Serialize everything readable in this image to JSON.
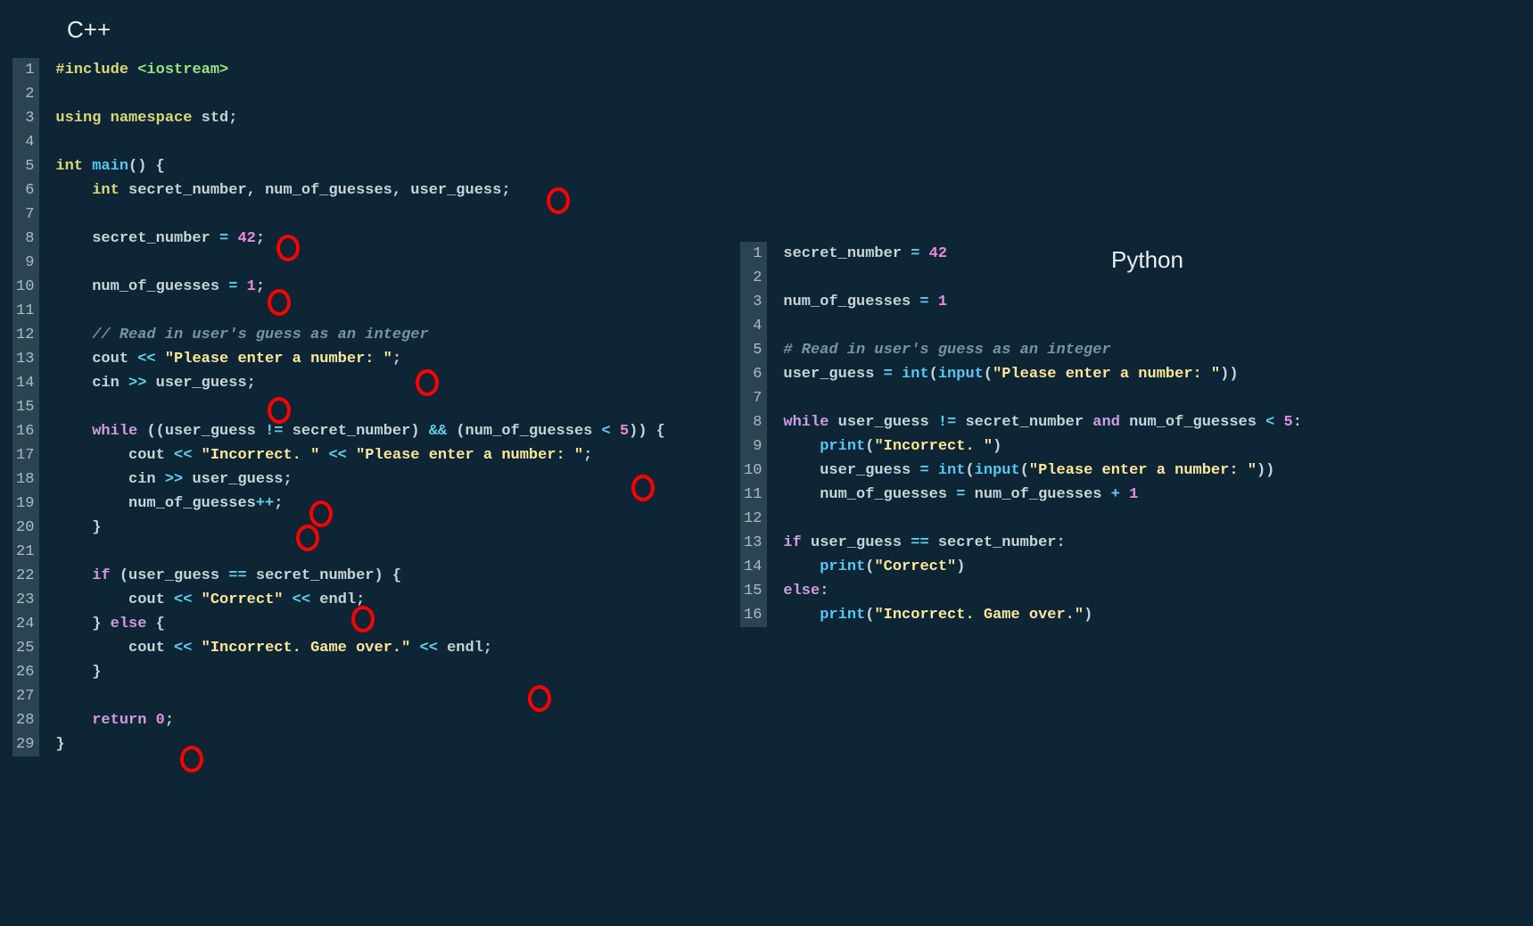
{
  "labels": {
    "cpp": "C++",
    "python": "Python"
  },
  "cpp": {
    "line_count": 29,
    "tokens": {
      "include": "#include ",
      "iostream": "<iostream>",
      "using": "using ",
      "namespace": "namespace ",
      "std": "std",
      "semi": ";",
      "int": "int ",
      "int2": "int ",
      "main": "main",
      "paren_open": "(",
      "paren_close": ")",
      "brace_open": " {",
      "brace_close": "}",
      "secret": "secret_number",
      "comma1": ", ",
      "numg": "num_of_guesses",
      "comma2": ", ",
      "userg": "user_guess",
      "assign": " = ",
      "n42": "42",
      "n1": "1",
      "cmt": "// Read in user's guess as an integer",
      "cout": "cout ",
      "cin": "cin ",
      "ltlt": "<< ",
      "gtgt": ">> ",
      "prompt": "\"Please enter a number: \"",
      "while": "while ",
      "neq": " != ",
      "ampamp": " && ",
      "lt": " < ",
      "n5": "5",
      "incstr": "\"Incorrect. \"",
      "plusplus": "++",
      "if": "if ",
      "eqeq": " == ",
      "else": " else ",
      "correct": "\"Correct\"",
      "endl": "endl",
      "gameover": "\"Incorrect. Game over.\"",
      "return": "return ",
      "n0": "0"
    }
  },
  "python": {
    "line_count": 16,
    "tokens": {
      "secret": "secret_number",
      "assign": " = ",
      "n42": "42",
      "numg": "num_of_guesses",
      "n1": "1",
      "cmt": "# Read in user's guess as an integer",
      "userg": "user_guess",
      "int": "int",
      "input": "input",
      "prompt": "\"Please enter a number: \"",
      "while": "while ",
      "neq": " != ",
      "and": " and ",
      "lt": " < ",
      "n5": "5",
      "colon": ":",
      "print": "print",
      "incstr": "\"Incorrect. \"",
      "plus": " + ",
      "if": "if ",
      "eqeq": " == ",
      "else": "else",
      "correct": "\"Correct\"",
      "gameover": "\"Incorrect. Game over.\""
    }
  },
  "colors": {
    "background": "#0d2534",
    "gutter_bg": "#2b4452",
    "circle": "#ff0000"
  }
}
